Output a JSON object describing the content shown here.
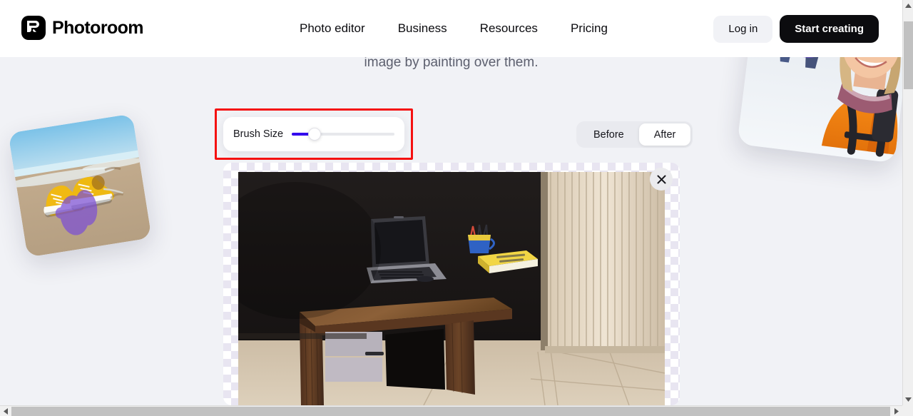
{
  "brand": {
    "name": "Photoroom",
    "logo_icon": "photoroom-logo-icon"
  },
  "nav": {
    "items": [
      {
        "label": "Photo editor"
      },
      {
        "label": "Business"
      },
      {
        "label": "Resources"
      },
      {
        "label": "Pricing"
      }
    ]
  },
  "header_actions": {
    "login_label": "Log in",
    "start_label": "Start creating"
  },
  "hero": {
    "subtitle": "image by painting over them."
  },
  "brush_panel": {
    "label": "Brush Size",
    "slider_value": 22,
    "slider_min": 0,
    "slider_max": 100,
    "fill_color": "#3300ee",
    "track_color": "#e7e8ec"
  },
  "compare_toggle": {
    "options": [
      {
        "label": "Before",
        "selected": false
      },
      {
        "label": "After",
        "selected": true
      }
    ]
  },
  "canvas": {
    "close_icon": "close-icon",
    "subject": "desk with laptop against dark wall",
    "transparency_checker": true
  },
  "floating_cards": [
    {
      "name": "shoes-card",
      "subject": "yellow sneakers on beach with purple brush stroke",
      "stroke_color": "#7c4fd4"
    },
    {
      "name": "snow-card",
      "subject": "smiling woman in orange jacket in snow with purple brush strokes",
      "stroke_color": "#7b4fd8"
    }
  ],
  "highlight": {
    "color": "#f51111"
  },
  "scrollbars": {
    "vertical_present": true,
    "horizontal_present": true,
    "up_arrow_icon": "caret-up-icon",
    "down_arrow_icon": "caret-down-icon",
    "left_arrow_icon": "caret-left-icon",
    "right_arrow_icon": "caret-right-icon"
  }
}
